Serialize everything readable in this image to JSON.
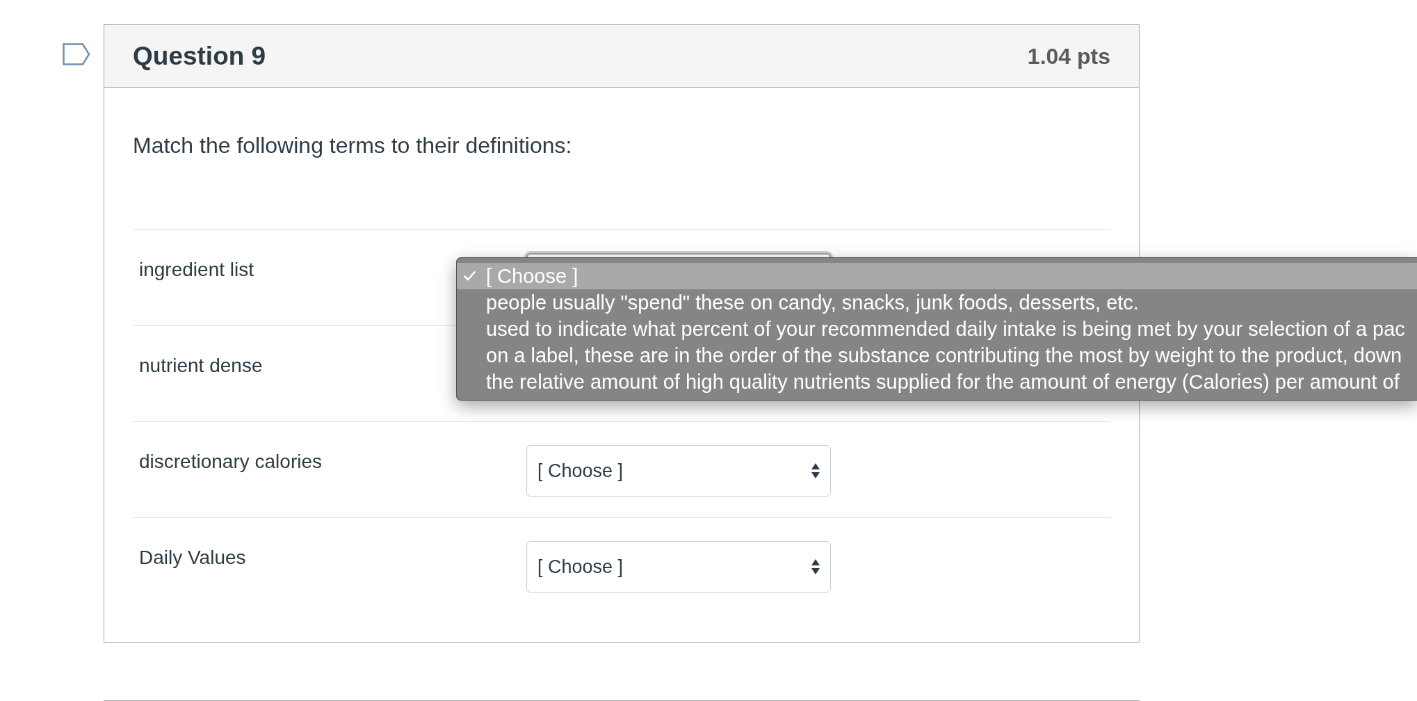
{
  "question": {
    "flagged": false,
    "title": "Question 9",
    "points": "1.04 pts",
    "prompt": "Match the following terms to their definitions:",
    "rows": [
      {
        "term": "ingredient list",
        "select": {
          "focused": true
        }
      },
      {
        "term": "nutrient dense"
      },
      {
        "term": "discretionary calories",
        "select": {
          "focused": false,
          "value": "[ Choose ]"
        }
      },
      {
        "term": "Daily Values",
        "select": {
          "focused": false,
          "value": "[ Choose ]"
        }
      }
    ],
    "dropdown": {
      "options": [
        {
          "label": "[ Choose ]",
          "selected": true
        },
        {
          "label": "people usually \"spend\" these on candy, snacks, junk foods, desserts, etc.",
          "selected": false
        },
        {
          "label": "used to indicate what percent of your recommended daily intake is being met by your selection of a pac",
          "selected": false
        },
        {
          "label": "on a label, these are in the order of the substance contributing the most by weight to the product, down",
          "selected": false
        },
        {
          "label": "the relative amount of high quality nutrients supplied for the amount of energy (Calories) per amount of",
          "selected": false
        }
      ]
    }
  }
}
